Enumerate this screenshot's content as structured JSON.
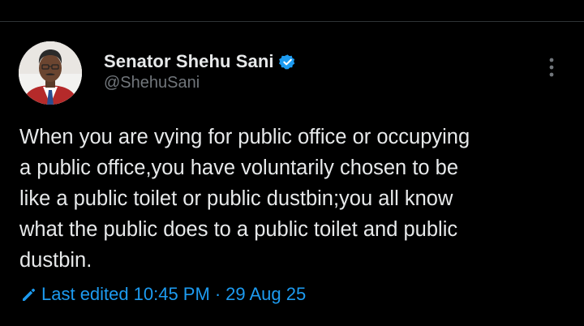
{
  "colors": {
    "background": "#000000",
    "text_primary": "#e7e9ea",
    "text_secondary": "#71767b",
    "accent": "#1d9bf0",
    "divider": "#2f3336"
  },
  "author": {
    "display_name": "Senator Shehu Sani",
    "handle": "@ShehuSani",
    "verified_icon": "verified-badge-icon",
    "avatar_icon": "profile-photo"
  },
  "tweet": {
    "lines": [
      "When you are vying for public office or occupying",
      "a public office,you have voluntarily chosen to be",
      "like a public toilet or public dustbin;you all know",
      "what the public does to a public toilet and public",
      "dustbin."
    ]
  },
  "meta": {
    "edited_label": "Last edited",
    "time": "10:45 PM",
    "separator": "·",
    "date": "29 Aug 25",
    "edit_icon": "pencil-icon"
  },
  "menu": {
    "more_icon": "more-vertical-icon"
  }
}
